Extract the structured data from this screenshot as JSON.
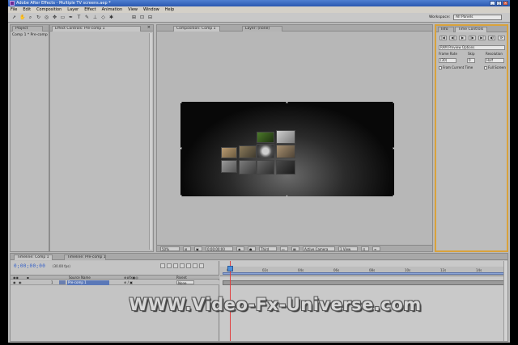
{
  "window": {
    "title": "Adobe After Effects - Multiple TV screens.aep *"
  },
  "menu": [
    "File",
    "Edit",
    "Composition",
    "Layer",
    "Effect",
    "Animation",
    "View",
    "Window",
    "Help"
  ],
  "toolbar": {
    "workspace_label": "Workspace:",
    "workspace_value": "All Panels"
  },
  "project_panel": {
    "tab": "Project",
    "subtitle": "Comp 1 * Pre-comp 1"
  },
  "effects_panel": {
    "tab": "Effect Controls: Pre-comp 1"
  },
  "composition_panel": {
    "tab_comp": "Composition: Comp 1",
    "tab_layer": "Layer: (none)",
    "footer": {
      "zoom": "50%",
      "timecode": "0;00;00;00",
      "resolution": "Third",
      "camera": "Active Camera",
      "view": "1 View"
    }
  },
  "time_controls": {
    "tab_info": "Info",
    "tab_time": "Time Controls",
    "buttons": [
      "|◀",
      "◀|",
      "▶",
      "|▶",
      "▶|",
      "◀)",
      "⟳",
      "▭"
    ],
    "preview_option": "RAM Preview Options",
    "frame_rate_label": "Frame Rate",
    "skip_label": "Skip",
    "resolution_label": "Resolution",
    "frame_rate_value": "(30)",
    "skip_value": "0",
    "resolution_value": "Half",
    "from_current_label": "From Current Time",
    "full_screen_label": "Full Screen"
  },
  "timeline": {
    "tab_comp": "Timeline: Comp 1",
    "tab_precomp": "Timeline: Pre-comp 1",
    "timecode": "0;00;00;00",
    "fps": "(30.00 fps)",
    "columns": {
      "source_name": "Source Name",
      "parent": "Parent"
    },
    "layer": {
      "number": "1",
      "name": "Pre-comp 1",
      "parent": "None"
    },
    "ruler_ticks": [
      "0s",
      "02s",
      "04s",
      "06s",
      "08s",
      "10s",
      "12s",
      "14s"
    ]
  },
  "watermark": "WWW.Video-Fx-Universe.com",
  "colors": {
    "accent_timecode": "#3460c8",
    "active_panel_border": "#d9a23b",
    "playhead": "#e04040"
  }
}
